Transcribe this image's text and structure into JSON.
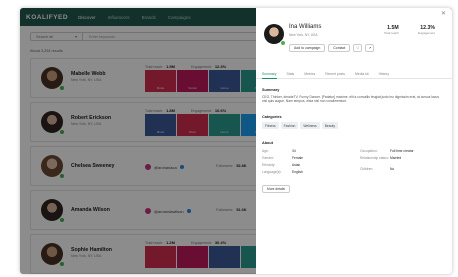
{
  "app": {
    "logo": "KOALIFYED",
    "nav": [
      "Discover",
      "Influencers",
      "Brands",
      "Campaigns"
    ]
  },
  "search": {
    "scope": "Search all",
    "placeholder": "Enter keywords",
    "results_label": "About 3,294 results"
  },
  "rows": [
    {
      "name": "Mabelle Webb",
      "location": "New York, NY, USA",
      "reach_label": "Total reach:",
      "reach": "1.5M",
      "eng_label": "Engagement:",
      "eng": "12.3%",
      "tiles": [
        "Mode",
        "Social",
        "Home",
        "Art"
      ]
    },
    {
      "name": "Robert Erickson",
      "location": "New York, NY, USA",
      "reach_label": "Total reach:",
      "reach": "1.8M",
      "eng_label": "Engagement:",
      "eng": "10.6%",
      "tiles": [
        "Mode",
        "Work",
        "Home",
        "Art"
      ]
    },
    {
      "name": "Chelsea Sweeney",
      "handle": "@archanaca",
      "followers_label": "Followers:",
      "followers": "92.8K"
    },
    {
      "name": "Amanda Wilson",
      "handle": "@amandawilson",
      "followers_label": "Followers:",
      "followers": "51.6K"
    },
    {
      "name": "Sophie Hamilton",
      "location": "New York, NY, USA",
      "reach_label": "Total reach:",
      "reach": "1.2M",
      "eng_label": "Engagement:",
      "eng": "30.4%"
    }
  ],
  "colors": {
    "topbar": "#1f5a4d",
    "accent": "#1f8a6e",
    "tile_red": "#d32f4f",
    "tile_blue": "#3b5998",
    "tile_teal": "#2a9d8f",
    "status_green": "#4caf50"
  },
  "drawer": {
    "close_icon": "close-icon",
    "name": "Ina Williams",
    "location": "New York, NY, USA",
    "reach": "1.5M",
    "reach_label": "Total reach",
    "engagement": "12.3%",
    "engagement_label": "Engagement",
    "add_campaign": "Add to campaign",
    "contact": "Contact",
    "tabs": [
      "Summary",
      "Stats",
      "Metrics",
      "Recent posts",
      "Media kit",
      "History"
    ],
    "summary_title": "Summary",
    "summary_text": "CEO, Thinker, #madeTV, Funny Dancer. [Pariatur] maxime, elit a convallis feugiat justo leo dignissim erat, at cursus lacus nisl quis augue. Nam tempus, elisa nisl non condimentum.",
    "categories_title": "Categories",
    "categories": [
      "Fitness",
      "Fashion",
      "Wellness",
      "Beauty"
    ],
    "about_title": "About",
    "about_left": [
      {
        "k": "Age:",
        "v": "34"
      },
      {
        "k": "Gender:",
        "v": "Female"
      },
      {
        "k": "Ethnicity:",
        "v": "Asian"
      },
      {
        "k": "Language(s):",
        "v": "English"
      }
    ],
    "about_right": [
      {
        "k": "Occupation:",
        "v": "Full time creator"
      },
      {
        "k": "Relationship status:",
        "v": "Married"
      },
      {
        "k": "Children:",
        "v": "No"
      }
    ],
    "more_details": "More details"
  }
}
